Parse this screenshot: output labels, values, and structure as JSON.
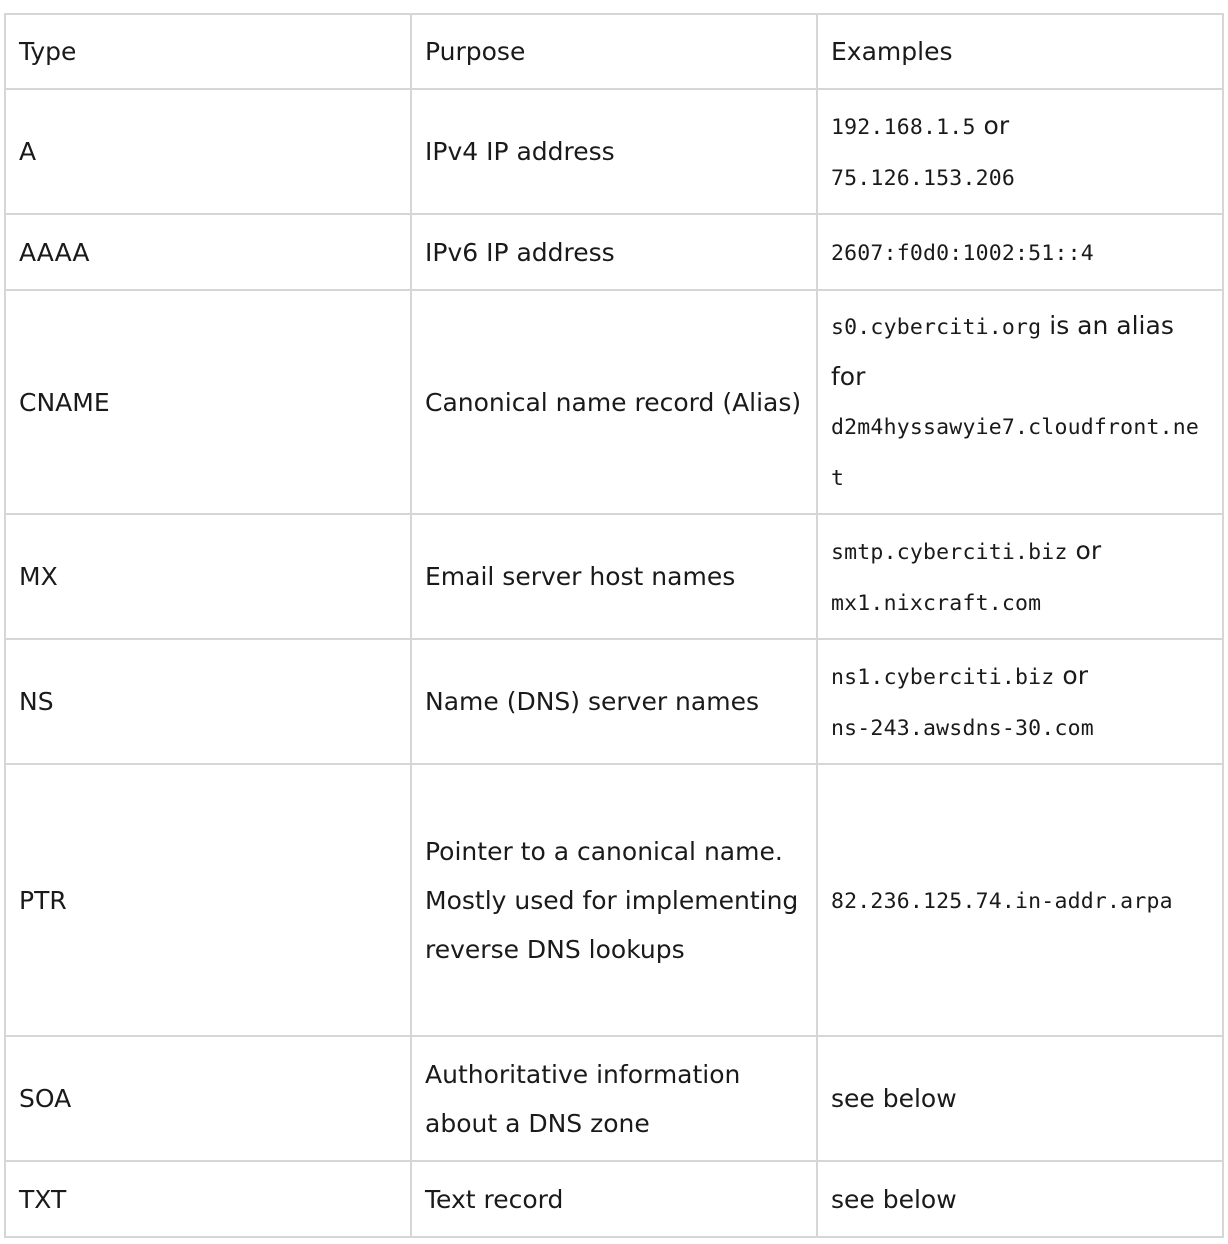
{
  "table": {
    "headers": [
      "Type",
      "Purpose",
      "Examples"
    ],
    "rows": [
      {
        "type": "A",
        "purpose": [
          "IPv4 IP address"
        ],
        "example": [
          [
            {
              "t": "192.168.1.5",
              "mono": true
            },
            {
              "t": " or",
              "mono": false
            }
          ],
          [
            {
              "t": "75.126.153.206",
              "mono": true
            }
          ]
        ],
        "height": 125
      },
      {
        "type": "AAAA",
        "purpose": [
          "IPv6 IP address"
        ],
        "example": [
          [
            {
              "t": "2607:f0d0:1002:51::4",
              "mono": true
            }
          ]
        ],
        "height": 76
      },
      {
        "type": "CNAME",
        "purpose": [
          "Canonical name record (Alias)"
        ],
        "example": [
          [
            {
              "t": "s0.cyberciti.org",
              "mono": true
            },
            {
              "t": " is an alias for",
              "mono": false
            }
          ],
          [
            {
              "t": "d2m4hyssawyie7.cloudfront.net",
              "mono": true
            }
          ]
        ],
        "height": 224
      },
      {
        "type": "MX",
        "purpose": [
          "Email server host names"
        ],
        "example": [
          [
            {
              "t": "smtp.cyberciti.biz",
              "mono": true
            },
            {
              "t": " or",
              "mono": false
            }
          ],
          [
            {
              "t": "mx1.nixcraft.com",
              "mono": true
            }
          ]
        ],
        "height": 125
      },
      {
        "type": "NS",
        "purpose": [
          "Name (DNS) server names"
        ],
        "example": [
          [
            {
              "t": "ns1.cyberciti.biz",
              "mono": true
            },
            {
              "t": " or",
              "mono": false
            }
          ],
          [
            {
              "t": "ns-243.awsdns-30.com",
              "mono": true
            }
          ]
        ],
        "height": 125
      },
      {
        "type": "PTR",
        "purpose": [
          "Pointer to a canonical name.",
          "Mostly used for implementing reverse DNS lookups"
        ],
        "example": [
          [
            {
              "t": "82.236.125.74.in-addr.arpa",
              "mono": true
            }
          ]
        ],
        "height": 272
      },
      {
        "type": "SOA",
        "purpose": [
          "Authoritative information about a DNS zone"
        ],
        "example": [
          [
            {
              "t": "see below",
              "mono": false
            }
          ]
        ],
        "height": 125
      },
      {
        "type": "TXT",
        "purpose": [
          "Text record"
        ],
        "example": [
          [
            {
              "t": "see below",
              "mono": false
            }
          ]
        ],
        "height": 76
      }
    ]
  }
}
